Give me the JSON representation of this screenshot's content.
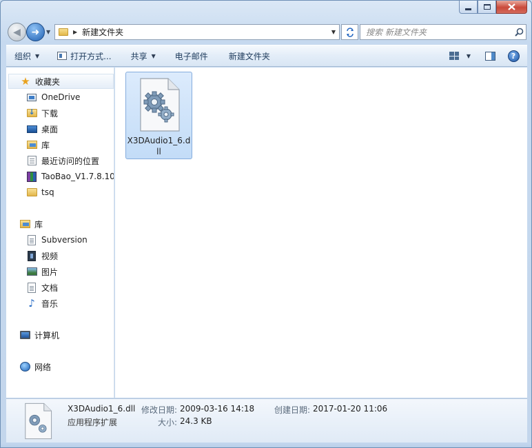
{
  "nav": {
    "address_path": "新建文件夹",
    "search_placeholder": "搜索 新建文件夹"
  },
  "toolbar": {
    "organize": "组织",
    "open_with": "打开方式...",
    "share": "共享",
    "email": "电子邮件",
    "new_folder": "新建文件夹"
  },
  "sidebar": {
    "favorites": {
      "header": "收藏夹",
      "items": [
        {
          "label": "OneDrive",
          "icon": "onedrive-icon"
        },
        {
          "label": "下载",
          "icon": "downloads-folder-icon"
        },
        {
          "label": "桌面",
          "icon": "desktop-icon"
        },
        {
          "label": "库",
          "icon": "library-icon"
        },
        {
          "label": "最近访问的位置",
          "icon": "recent-places-icon"
        },
        {
          "label": "TaoBao_V1.7.8.10_",
          "icon": "winrar-archive-icon"
        },
        {
          "label": "tsq",
          "icon": "folder-icon"
        }
      ]
    },
    "libraries": {
      "header": "库",
      "items": [
        {
          "label": "Subversion",
          "icon": "document-icon"
        },
        {
          "label": "视频",
          "icon": "video-icon"
        },
        {
          "label": "图片",
          "icon": "pictures-icon"
        },
        {
          "label": "文档",
          "icon": "documents-icon"
        },
        {
          "label": "音乐",
          "icon": "music-icon"
        }
      ]
    },
    "computer": "计算机",
    "network": "网络"
  },
  "files": [
    {
      "name": "X3DAudio1_6.dll",
      "icon": "dll-gear-file-icon",
      "selected": true
    }
  ],
  "details": {
    "name": "X3DAudio1_6.dll",
    "type": "应用程序扩展",
    "modified_label": "修改日期:",
    "modified_value": "2009-03-16 14:18",
    "created_label": "创建日期:",
    "created_value": "2017-01-20 11:06",
    "size_label": "大小:",
    "size_value": "24.3 KB"
  },
  "colors": {
    "accent": "#1e5fb2",
    "selection": "#cce1f8",
    "frame": "#c6d9ef"
  }
}
